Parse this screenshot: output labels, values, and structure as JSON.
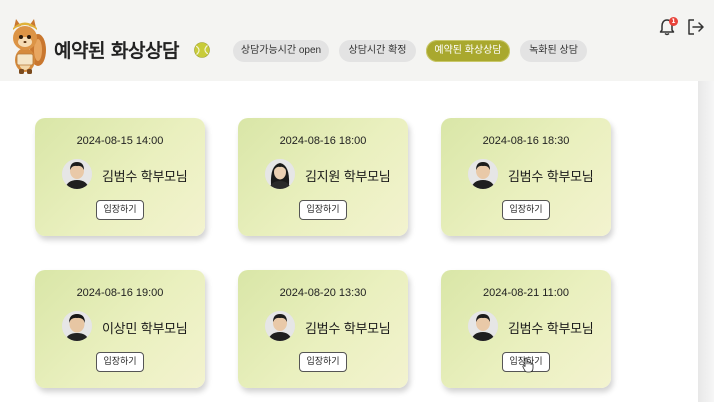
{
  "header": {
    "title": "예약된 화상상담",
    "mascot_icon": "squirrel-mascot-icon",
    "title_icon": "tennis-ball-icon",
    "tabs": [
      {
        "label": "상담가능시간 open",
        "active": false
      },
      {
        "label": "상담시간 확정",
        "active": false
      },
      {
        "label": "예약된 화상상담",
        "active": true
      },
      {
        "label": "녹화된 상담",
        "active": false
      }
    ],
    "notification_icon": "bell-icon",
    "notification_count": "1",
    "logout_icon": "logout-icon"
  },
  "colors": {
    "active_tab": "#a9a82e",
    "card_gradient_start": "#d9e6a7",
    "card_gradient_end": "#f3f3cf",
    "badge": "#e8433a"
  },
  "cards": [
    {
      "datetime": "2024-08-15 14:00",
      "name": "김범수 학부모님",
      "button": "입장하기",
      "avatar": "boy"
    },
    {
      "datetime": "2024-08-16 18:00",
      "name": "김지원 학부모님",
      "button": "입장하기",
      "avatar": "girl"
    },
    {
      "datetime": "2024-08-16 18:30",
      "name": "김범수 학부모님",
      "button": "입장하기",
      "avatar": "boy"
    },
    {
      "datetime": "2024-08-16 19:00",
      "name": "이상민 학부모님",
      "button": "입장하기",
      "avatar": "boy"
    },
    {
      "datetime": "2024-08-20 13:30",
      "name": "김범수 학부모님",
      "button": "입장하기",
      "avatar": "boy"
    },
    {
      "datetime": "2024-08-21 11:00",
      "name": "김범수 학부모님",
      "button": "입장하기",
      "avatar": "boy"
    }
  ]
}
